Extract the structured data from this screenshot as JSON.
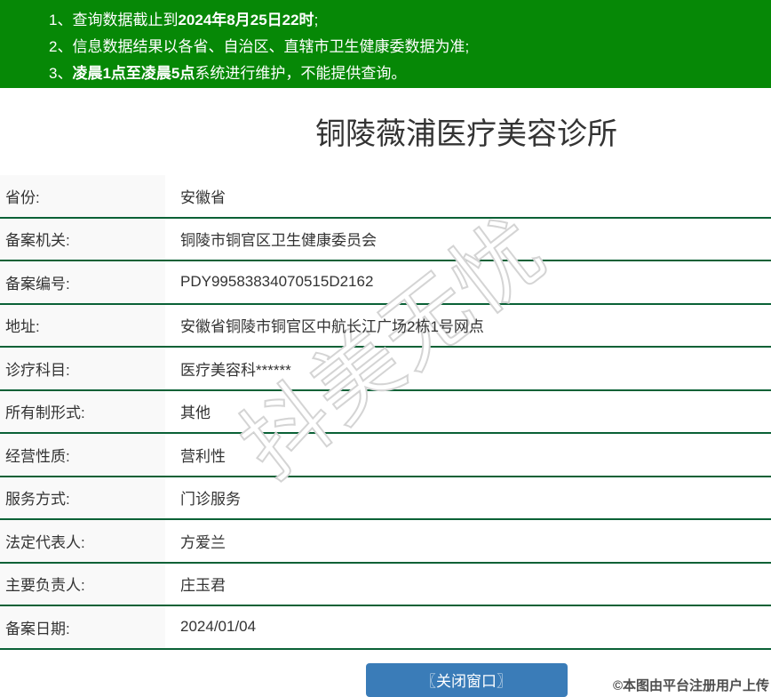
{
  "notice_banner": {
    "bg_color": "#068806",
    "items": [
      {
        "num": "1、",
        "pre": "查询数据截止到",
        "bold": "2024年8月25日22时",
        "post": ";"
      },
      {
        "num": "2、",
        "pre": "信息数据结果以各省、自治区、直辖市卫生健康委数据为准;",
        "bold": "",
        "post": ""
      },
      {
        "num": "3、",
        "pre": "",
        "bold": "凌晨1点至凌晨5点",
        "post": "系统进行维护，不能提供查询。"
      }
    ]
  },
  "page_title": "铜陵薇浦医疗美容诊所",
  "info_table": {
    "separator_color": "#0a6136",
    "label_bg": "#f9f9f9",
    "rows": [
      {
        "label": "省份:",
        "value": "安徽省"
      },
      {
        "label": "备案机关:",
        "value": "铜陵市铜官区卫生健康委员会"
      },
      {
        "label": "备案编号:",
        "value": "PDY99583834070515D2162"
      },
      {
        "label": "地址:",
        "value": "安徽省铜陵市铜官区中航长江广场2栋1号网点"
      },
      {
        "label": "诊疗科目:",
        "value": "医疗美容科******"
      },
      {
        "label": "所有制形式:",
        "value": "其他"
      },
      {
        "label": "经营性质:",
        "value": "营利性"
      },
      {
        "label": "服务方式:",
        "value": "门诊服务"
      },
      {
        "label": "法定代表人:",
        "value": "方爱兰"
      },
      {
        "label": "主要负责人:",
        "value": "庄玉君"
      },
      {
        "label": "备案日期:",
        "value": "2024/01/04"
      }
    ]
  },
  "close_button": {
    "label": "〖关闭窗口〗",
    "bg_color": "#3a7cb8"
  },
  "watermarks": {
    "diagonal_text": "抖美无忧",
    "credit_text": "©本图由平台注册用户上传"
  }
}
